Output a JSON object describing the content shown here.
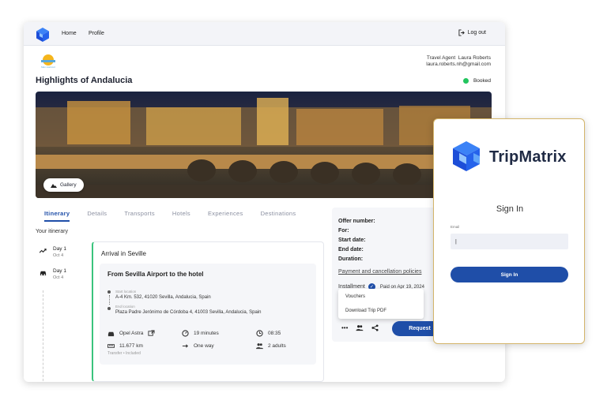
{
  "nav": {
    "home": "Home",
    "profile": "Profile",
    "logout": "Log out"
  },
  "agency": {
    "logo_text": "Max Horizont"
  },
  "agent": {
    "role": "Travel Agent",
    "name": "Laura Roberts",
    "email": "laura.roberts.nh@gmail.com"
  },
  "trip": {
    "title": "Highlights of Andalucia",
    "status": "Booked",
    "status_color": "#22c55e"
  },
  "hero": {
    "gallery_label": "Gallery"
  },
  "tabs": [
    "Itinerary",
    "Details",
    "Transports",
    "Hotels",
    "Experiences",
    "Destinations"
  ],
  "itinerary": {
    "heading": "Your itinerary",
    "days": [
      {
        "label": "Day 1",
        "date": "Oct 4",
        "icon": "trend-icon"
      },
      {
        "label": "Day 1",
        "date": "Oct 4",
        "icon": "car-icon"
      }
    ],
    "card": {
      "title": "Arrival in Seville",
      "transfer": {
        "title": "From Sevilla Airport to the hotel",
        "start_label": "Start location",
        "start": "A-4 Km. 532, 41020 Sevilla, Andalucia, Spain",
        "end_label": "End location",
        "end": "Plaza Padre Jerónimo de Córdoba 4, 41003 Sevilla, Andalucia, Spain",
        "car": "Opel Astra",
        "duration": "19 minutes",
        "time": "08:35",
        "distance": "11.677 km",
        "direction": "One way",
        "pax": "2 adults",
        "footer": "Transfer • Included"
      }
    }
  },
  "offer": {
    "rows": [
      "Offer number:",
      "For:",
      "Start date:",
      "End date:",
      "Duration:"
    ],
    "policies": "Payment and cancellation policies",
    "installment": "Installment",
    "paid": "Paid on Apr 19, 2024",
    "dropdown": [
      "Vouchers",
      "Download Trip PDF"
    ],
    "more_icon": "•••",
    "request_label": "Request"
  },
  "signin": {
    "brand": "TripMatrix",
    "title": "Sign In",
    "email_label": "Email",
    "email_value": "|",
    "button": "Sign In"
  },
  "colors": {
    "primary": "#1f4ea8",
    "accent_green": "#3ac47d",
    "border_gold": "#d4b56a"
  }
}
